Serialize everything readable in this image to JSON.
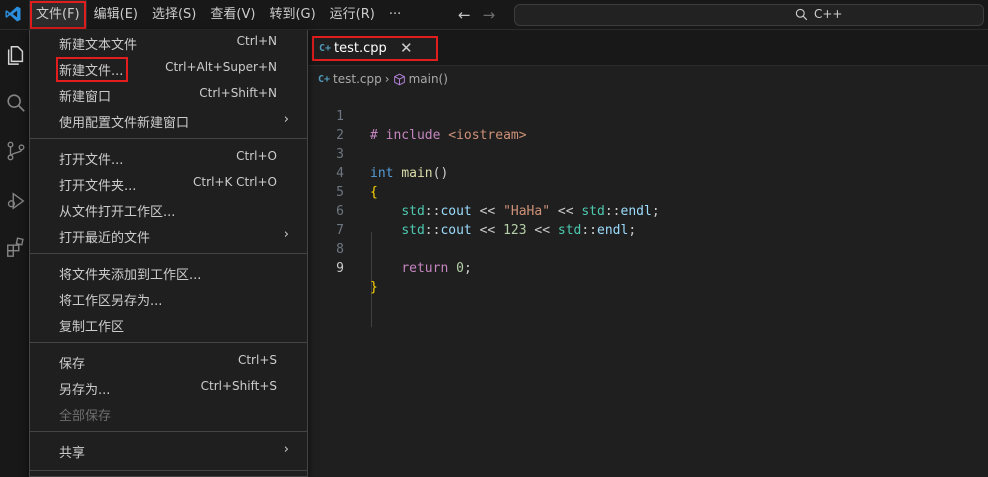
{
  "menubar": {
    "items": [
      {
        "label": "文件(F)",
        "active": true
      },
      {
        "label": "编辑(E)"
      },
      {
        "label": "选择(S)"
      },
      {
        "label": "查看(V)"
      },
      {
        "label": "转到(G)"
      },
      {
        "label": "运行(R)"
      },
      {
        "label": "···"
      }
    ]
  },
  "nav": {
    "back": "←",
    "forward": "→"
  },
  "command_center": {
    "text": "C++"
  },
  "file_menu": {
    "new_text_file": {
      "label": "新建文本文件",
      "key": "Ctrl+N"
    },
    "new_file": {
      "label": "新建文件...",
      "key": "Ctrl+Alt+Super+N"
    },
    "new_window": {
      "label": "新建窗口",
      "key": "Ctrl+Shift+N"
    },
    "new_window_profile": {
      "label": "使用配置文件新建窗口",
      "arrow": "›"
    },
    "open_file": {
      "label": "打开文件...",
      "key": "Ctrl+O"
    },
    "open_folder": {
      "label": "打开文件夹...",
      "key": "Ctrl+K Ctrl+O"
    },
    "open_workspace": {
      "label": "从文件打开工作区..."
    },
    "open_recent": {
      "label": "打开最近的文件",
      "arrow": "›"
    },
    "add_folder": {
      "label": "将文件夹添加到工作区..."
    },
    "save_workspace_as": {
      "label": "将工作区另存为..."
    },
    "duplicate_workspace": {
      "label": "复制工作区"
    },
    "save": {
      "label": "保存",
      "key": "Ctrl+S"
    },
    "save_as": {
      "label": "另存为...",
      "key": "Ctrl+Shift+S"
    },
    "save_all": {
      "label": "全部保存",
      "disabled": true
    },
    "share": {
      "label": "共享",
      "arrow": "›"
    }
  },
  "editor": {
    "tab": {
      "icon": "C+",
      "label": "test.cpp",
      "close": "✕"
    },
    "breadcrumb": {
      "icon": "C+",
      "file": "test.cpp",
      "sep": "›",
      "symbol": "main()"
    },
    "line_numbers": [
      "1",
      "2",
      "3",
      "4",
      "5",
      "6",
      "7",
      "8",
      "9"
    ],
    "code": {
      "l1": {
        "hash": "#",
        "kw": " include",
        "inc": " <iostream>"
      },
      "l3": {
        "type": "int",
        "fn": "main",
        "parens": "()"
      },
      "l4": {
        "brace": "{"
      },
      "l5": {
        "ns1": "std",
        "op1": "::",
        "v1": "cout",
        "op2": " << ",
        "str": "\"HaHa\"",
        "op3": " << ",
        "ns2": "std",
        "op4": "::",
        "v2": "endl",
        "semi": ";"
      },
      "l6": {
        "ns1": "std",
        "op1": "::",
        "v1": "cout",
        "op2": " << ",
        "num": "123",
        "op3": " << ",
        "ns2": "std",
        "op4": "::",
        "v2": "endl",
        "semi": ";"
      },
      "l8": {
        "kw": "return",
        "sp": " ",
        "num": "0",
        "semi": ";"
      },
      "l9": {
        "brace": "}"
      }
    }
  },
  "colors": {
    "highlight_box": "#e11d1d",
    "accent": "#0078d4"
  }
}
